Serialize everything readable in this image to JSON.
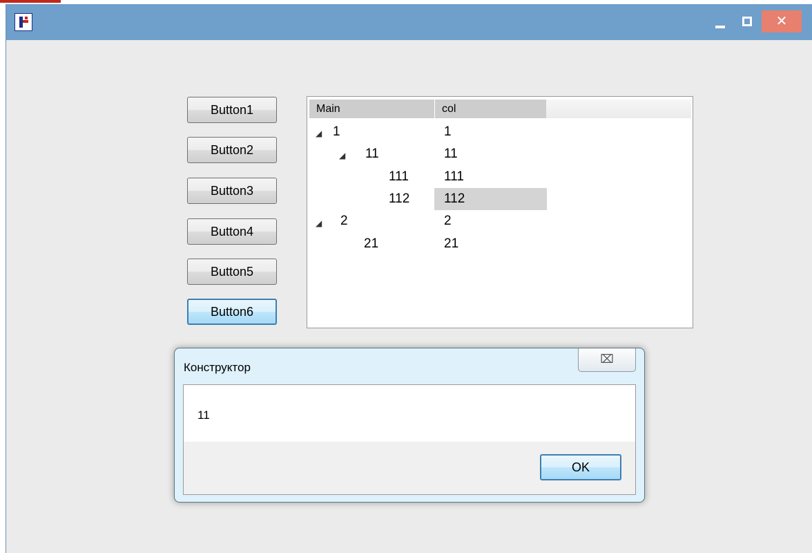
{
  "buttons": [
    "Button1",
    "Button2",
    "Button3",
    "Button4",
    "Button5",
    "Button6"
  ],
  "tree": {
    "columns": [
      "Main",
      "col"
    ],
    "rows": [
      {
        "main": "1",
        "col": "1",
        "expanded": true
      },
      {
        "main": "11",
        "col": "11",
        "expanded": true
      },
      {
        "main": "111",
        "col": "111"
      },
      {
        "main": "112",
        "col": "112",
        "selected": true
      },
      {
        "main": "2",
        "col": "2",
        "expanded": true
      },
      {
        "main": "21",
        "col": "21"
      }
    ]
  },
  "dialog": {
    "title": "Конструктор",
    "close_glyph": "⌧",
    "message": "11",
    "ok_label": "OK"
  },
  "titlebar": {
    "close_glyph": "✕"
  }
}
